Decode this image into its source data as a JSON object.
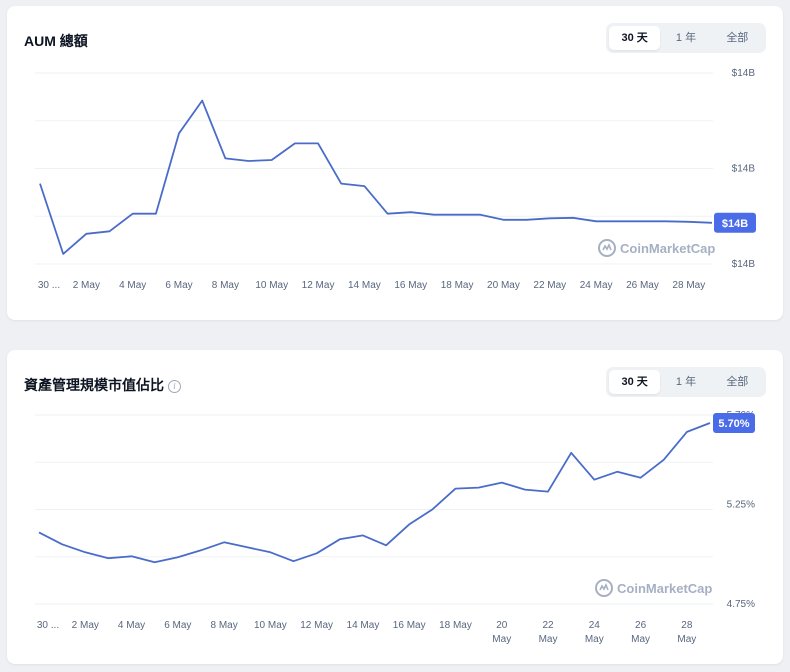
{
  "colors": {
    "line": "#4a6cc9",
    "grid": "#eff2f5",
    "badge": "#4a6ce8",
    "watermark": "#a6b0c3"
  },
  "watermark": "CoinMarketCap",
  "watermark_icon": "coinmarketcap-logo-icon",
  "charts": [
    {
      "title": "AUM 總額",
      "tabs": [
        {
          "label": "30 天",
          "active": true
        },
        {
          "label": "1 年",
          "active": false
        },
        {
          "label": "全部",
          "active": false
        }
      ],
      "badge": "$14B"
    },
    {
      "title": "資產管理規模市值佔比",
      "info_icon": "info-icon",
      "tabs": [
        {
          "label": "30 天",
          "active": true
        },
        {
          "label": "1 年",
          "active": false
        },
        {
          "label": "全部",
          "active": false
        }
      ],
      "badge": "5.70%"
    }
  ],
  "chart_data": [
    {
      "type": "line",
      "title": "AUM 總額",
      "y_ticks": [
        "$14B",
        "$14B",
        "$14B"
      ],
      "y_tick_values": [
        14.53,
        14.34,
        14.15
      ],
      "ylim": [
        14.15,
        14.53
      ],
      "x_tick_labels": [
        "30 ...",
        "2 May",
        "4 May",
        "6 May",
        "8 May",
        "10 May",
        "12 May",
        "14 May",
        "16 May",
        "18 May",
        "20 May",
        "22 May",
        "24 May",
        "26 May",
        "28 May"
      ],
      "x": [
        0,
        1,
        2,
        3,
        4,
        5,
        6,
        7,
        8,
        9,
        10,
        11,
        12,
        13,
        14,
        15,
        16,
        17,
        18,
        19,
        20,
        21,
        22,
        23,
        24,
        25,
        26,
        27,
        28,
        29
      ],
      "values": [
        14.31,
        14.17,
        14.21,
        14.215,
        14.25,
        14.25,
        14.41,
        14.475,
        14.36,
        14.355,
        14.357,
        14.39,
        14.39,
        14.31,
        14.305,
        14.25,
        14.253,
        14.248,
        14.248,
        14.248,
        14.238,
        14.238,
        14.241,
        14.242,
        14.235,
        14.235,
        14.235,
        14.235,
        14.234,
        14.232
      ],
      "last_value_label": "$14B"
    },
    {
      "type": "line",
      "title": "資產管理規模市值佔比",
      "y_ticks": [
        "5.70%",
        "5.25%",
        "4.75%"
      ],
      "y_tick_values": [
        5.7,
        5.25,
        4.75
      ],
      "ylim": [
        4.75,
        5.7
      ],
      "x_tick_labels": [
        "30 ...",
        "2 May",
        "4 May",
        "6 May",
        "8 May",
        "10 May",
        "12 May",
        "14 May",
        "16 May",
        "18 May",
        "20 May",
        "22 May",
        "24 May",
        "26 May",
        "28 May"
      ],
      "x": [
        0,
        1,
        2,
        3,
        4,
        5,
        6,
        7,
        8,
        9,
        10,
        11,
        12,
        13,
        14,
        15,
        16,
        17,
        18,
        19,
        20,
        21,
        22,
        23,
        24,
        25,
        26,
        27,
        28,
        29
      ],
      "values": [
        5.11,
        5.05,
        5.01,
        4.98,
        4.99,
        4.96,
        4.985,
        5.02,
        5.06,
        5.035,
        5.01,
        4.965,
        5.005,
        5.075,
        5.095,
        5.045,
        5.15,
        5.225,
        5.33,
        5.335,
        5.36,
        5.325,
        5.315,
        5.51,
        5.375,
        5.415,
        5.385,
        5.475,
        5.615,
        5.66
      ],
      "last_value_label": "5.70%"
    }
  ]
}
